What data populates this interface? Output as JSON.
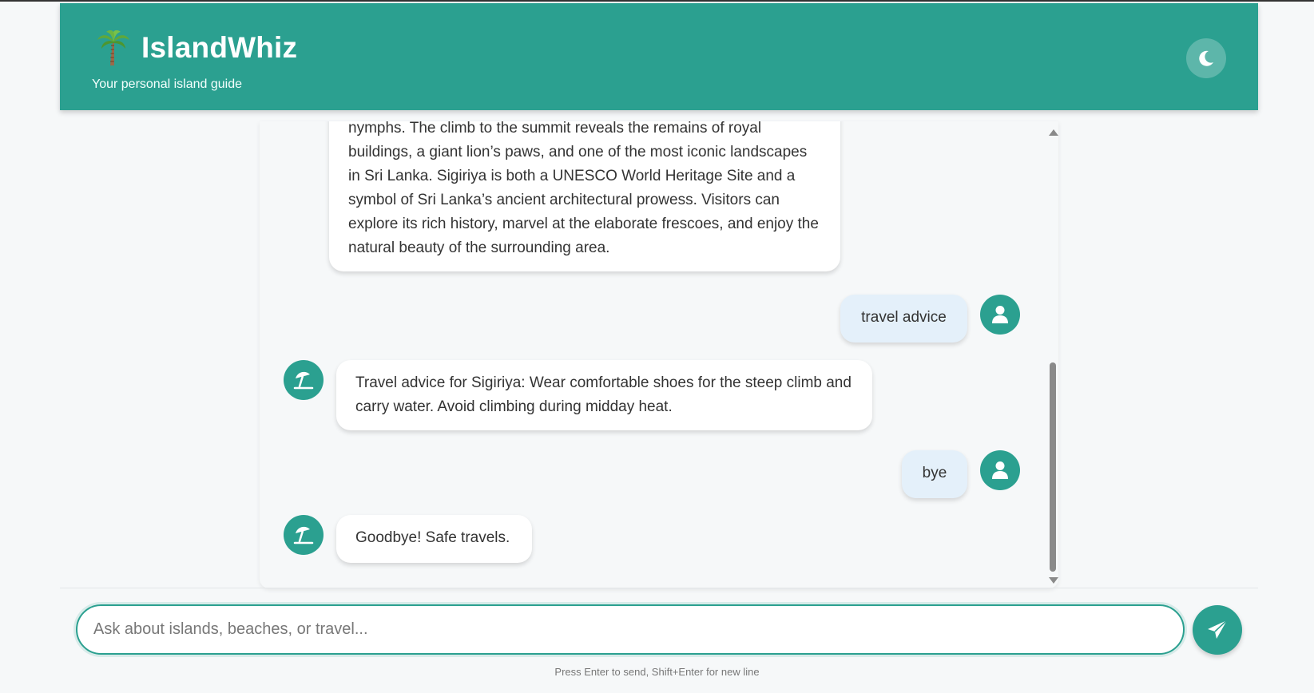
{
  "header": {
    "brand_icon": "palm-tree-icon",
    "title": "IslandWhiz",
    "tagline": "Your personal island guide",
    "theme_toggle_icon": "moon-icon"
  },
  "colors": {
    "primary": "#2ba090",
    "bot_bubble": "#ffffff",
    "user_bubble": "#e4f0fa",
    "background": "#f6f8f9"
  },
  "messages": [
    {
      "role": "bot",
      "text": "nymphs. The climb to the summit reveals the remains of royal buildings, a giant lion’s paws, and one of the most iconic landscapes in Sri Lanka. Sigiriya is both a UNESCO World Heritage Site and a symbol of Sri Lanka’s ancient architectural prowess. Visitors can explore its rich history, marvel at the elaborate frescoes, and enjoy the natural beauty of the surrounding area."
    },
    {
      "role": "user",
      "text": "travel advice",
      "avatar_icon": "user-icon"
    },
    {
      "role": "bot",
      "text": "Travel advice for Sigiriya: Wear comfortable shoes for the steep climb and carry water. Avoid climbing during midday heat.",
      "avatar_icon": "beach-umbrella-icon"
    },
    {
      "role": "user",
      "text": "bye",
      "avatar_icon": "user-icon"
    },
    {
      "role": "bot",
      "text": "Goodbye! Safe travels.",
      "avatar_icon": "beach-umbrella-icon"
    }
  ],
  "composer": {
    "placeholder": "Ask about islands, beaches, or travel...",
    "value": "",
    "send_icon": "paper-plane-icon",
    "hint": "Press Enter to send, Shift+Enter for new line"
  }
}
